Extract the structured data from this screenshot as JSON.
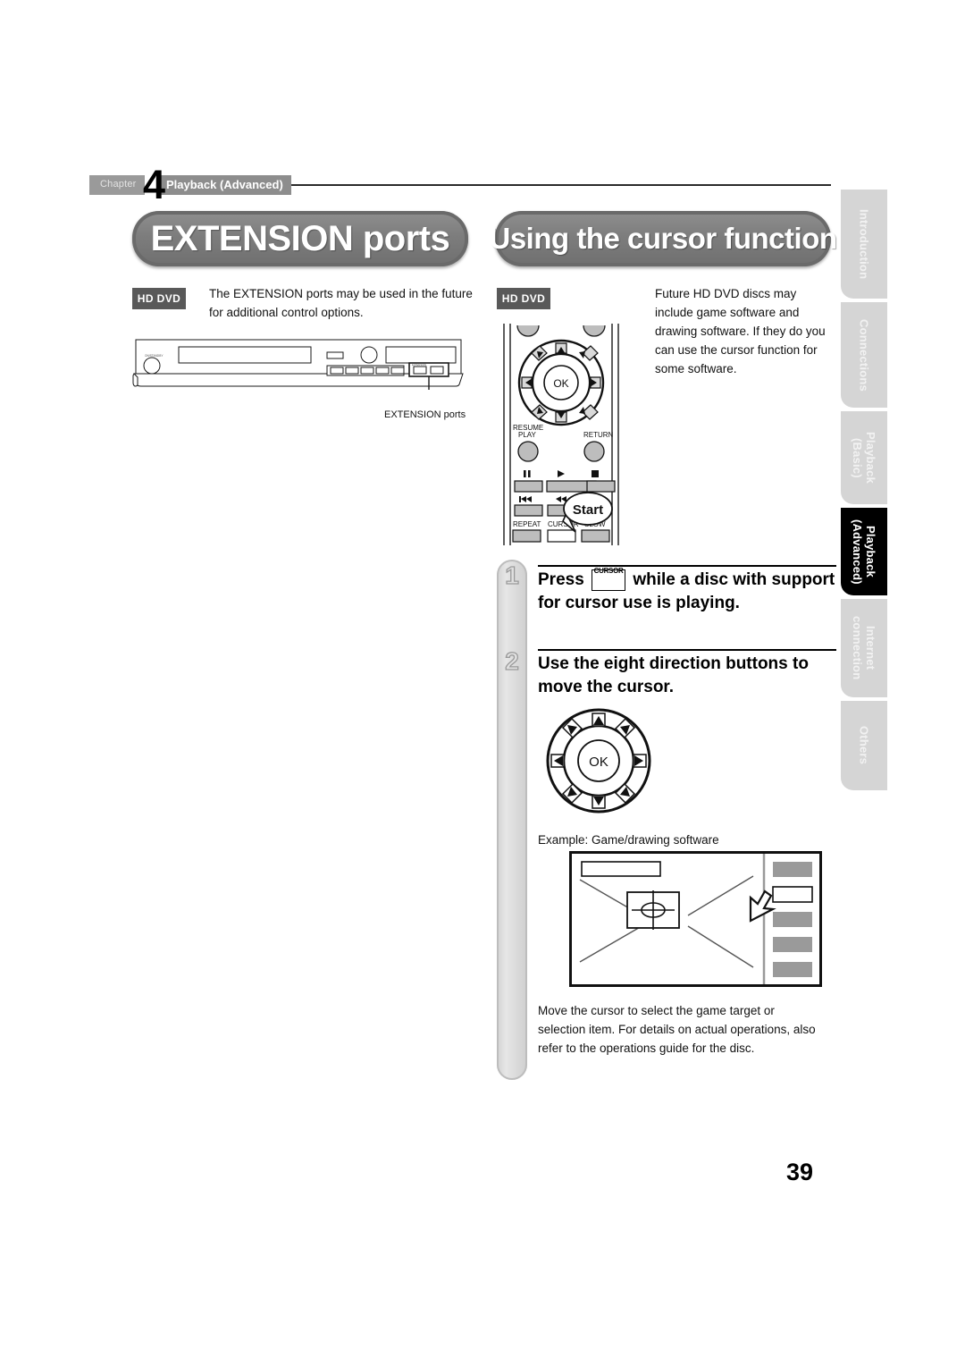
{
  "chapter": {
    "label": "Chapter",
    "number": "4",
    "title": "Playback (Advanced)"
  },
  "sections": {
    "left": {
      "banner": "EXTENSION ports",
      "badge": "HD DVD",
      "body": "The EXTENSION ports may be used in the future for additional control options.",
      "figure_caption": "EXTENSION ports"
    },
    "right": {
      "banner": "Using the cursor function",
      "badge": "HD DVD",
      "body": "Future HD DVD discs may include game software and drawing software. If they do you can use the cursor function for some software."
    }
  },
  "remote": {
    "ok_label": "OK",
    "resume_label_line1": "RESUME",
    "resume_label_line2": "PLAY",
    "return_label": "RETURN",
    "repeat_label": "REPEAT",
    "cursor_label": "CURSOR",
    "slow_label": "SLOW",
    "callout": "Start"
  },
  "steps": [
    {
      "number": "1",
      "text_before": "Press",
      "key_label": "CURSOR",
      "text_after": "while a disc with support for cursor use is playing."
    },
    {
      "number": "2",
      "text_before": "Use the eight direction buttons to move the cursor.",
      "key_label": "",
      "text_after": ""
    }
  ],
  "dpad": {
    "ok_label": "OK"
  },
  "example": {
    "label": "Example: Game/drawing software",
    "menu_items": 5,
    "selected_index": 1
  },
  "bottom_note": "Move the cursor to select the game target or selection item. For details on actual operations, also refer to the operations guide for the disc.",
  "side_tabs": [
    {
      "label": "Introduction",
      "active": false
    },
    {
      "label": "Connections",
      "active": false
    },
    {
      "label": "Playback\n(Basic)",
      "active": false
    },
    {
      "label": "Playback\n(Advanced)",
      "active": true
    },
    {
      "label": "Internet\nconnection",
      "active": false
    },
    {
      "label": "Others",
      "active": false
    }
  ],
  "page_number": "39",
  "colors": {
    "banner": "#7d7d7d",
    "badge": "#595959",
    "chapter_bar": "#8d8d8d",
    "tab_inactive": "#d5d5d5",
    "tab_active": "#000000"
  }
}
